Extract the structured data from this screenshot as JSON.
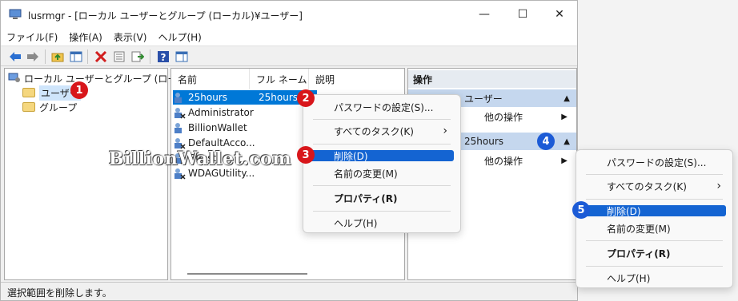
{
  "window": {
    "title": "lusrmgr - [ローカル ユーザーとグループ (ローカル)¥ユーザー]",
    "controls": {
      "minimize": "—",
      "maximize": "☐",
      "close": "✕"
    }
  },
  "menubar": {
    "items": [
      "ファイル(F)",
      "操作(A)",
      "表示(V)",
      "ヘルプ(H)"
    ]
  },
  "toolbar": {
    "icons": [
      "back-icon",
      "forward-icon",
      "up-folder-icon",
      "show-tree-icon",
      "delete-icon",
      "properties-icon",
      "export-icon",
      "help-icon",
      "action-pane-icon"
    ]
  },
  "tree": {
    "root": "ローカル ユーザーとグループ (ローカル)",
    "children": [
      "ユーザー",
      "グループ"
    ]
  },
  "list": {
    "columns": [
      "名前",
      "フル ネーム",
      "説明"
    ],
    "rows": [
      {
        "name": "25hours",
        "full_name": "25hours"
      },
      {
        "name": "Administrator",
        "full_name": ""
      },
      {
        "name": "BillionWallet",
        "full_name": ""
      },
      {
        "name": "DefaultAcco...",
        "full_name": ""
      },
      {
        "name": "Guest",
        "full_name": ""
      },
      {
        "name": "WDAGUtility...",
        "full_name": ""
      }
    ]
  },
  "actions": {
    "header": "操作",
    "group1": "ユーザー",
    "group1_item": "他の操作",
    "group2": "25hours",
    "group2_item": "他の操作"
  },
  "context_menu": {
    "items": [
      "パスワードの設定(S)...",
      "すべてのタスク(K)",
      "削除(D)",
      "名前の変更(M)",
      "プロパティ(R)",
      "ヘルプ(H)"
    ],
    "submenu_arrow": "›"
  },
  "status": {
    "text": "選択範囲を削除します。"
  },
  "badges": [
    "1",
    "2",
    "3",
    "4",
    "5"
  ],
  "watermark": "BillionWallet.com",
  "colors": {
    "selection": "#0078d7",
    "menu_highlight": "#1464d2",
    "badge_red": "#d8161b",
    "badge_blue": "#1c5bd6",
    "action_header": "#c5d7ee"
  }
}
